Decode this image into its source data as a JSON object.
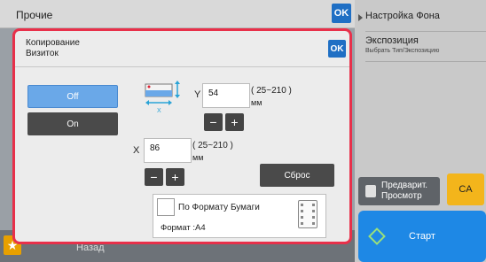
{
  "background": {
    "title": "Прочие",
    "ok_label": "OK"
  },
  "right_panel": {
    "items": [
      {
        "label": "Настройка Фона",
        "sub": ""
      },
      {
        "label": "Экспозиция",
        "sub": "Выбрать Тип/Экспозицию"
      }
    ],
    "preview_label_1": "Предварит.",
    "preview_label_2": "Просмотр",
    "ca_label": "CA",
    "start_label": "Старт"
  },
  "bottom_bar": {
    "back_label": "Назад"
  },
  "modal": {
    "title_line1": "Копирование",
    "title_line2": "Визиток",
    "ok_label": "OK",
    "toggle": {
      "off_label": "Off",
      "on_label": "On",
      "selected": "Off"
    },
    "y": {
      "axis": "Y",
      "value": "54",
      "range": "( 25~210 )",
      "unit": "мм",
      "minus": "−",
      "plus": "+"
    },
    "x": {
      "axis": "X",
      "value": "86",
      "range": "( 25~210 )",
      "unit": "мм",
      "minus": "−",
      "plus": "+"
    },
    "reset_label": "Сброс",
    "paper": {
      "label": "По Формату Бумаги",
      "format_label": "Формат",
      "format_value": ":A4",
      "checked": false
    }
  },
  "colors": {
    "accent_blue": "#1f6fc4",
    "modal_border": "#e8304a",
    "selected_toggle": "#6aa8e8",
    "start_button": "#1e88e5",
    "ca_button": "#f3b51b"
  }
}
